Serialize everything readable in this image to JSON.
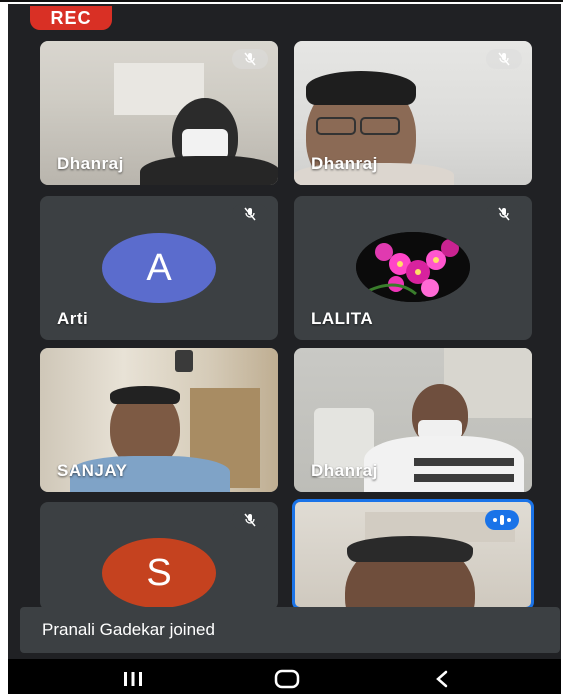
{
  "recording": {
    "label": "REC",
    "color": "#d93025"
  },
  "participants": [
    {
      "name": "Dhanraj",
      "type": "video",
      "muted": true
    },
    {
      "name": "Dhanraj",
      "type": "video",
      "muted": true
    },
    {
      "name": "Arti",
      "type": "avatar",
      "initial": "A",
      "avatar_color": "#5b6ccd",
      "muted": true
    },
    {
      "name": "LALITA",
      "type": "photo",
      "muted": true
    },
    {
      "name": "SANJAY",
      "type": "video",
      "muted": false
    },
    {
      "name": "Dhanraj",
      "type": "video",
      "muted": false
    },
    {
      "name": "",
      "type": "avatar",
      "initial": "S",
      "avatar_color": "#c5421f",
      "muted": true
    },
    {
      "name": "",
      "type": "video",
      "speaking": true,
      "highlight_color": "#1a73e8"
    }
  ],
  "notification": {
    "text": "Pranali Gadekar joined"
  },
  "navigation": {
    "recents": "recents-icon",
    "home": "home-icon",
    "back": "back-icon"
  }
}
